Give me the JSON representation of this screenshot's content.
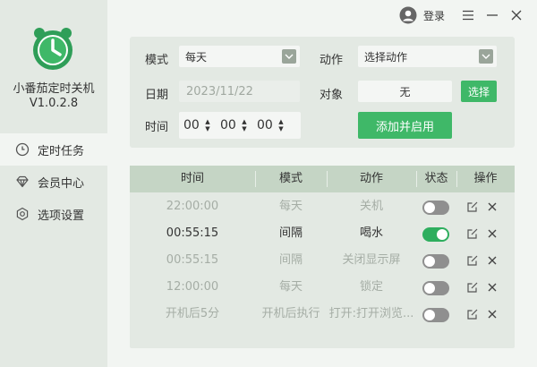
{
  "app": {
    "name": "小番茄定时关机",
    "version": "V1.0.2.8"
  },
  "titlebar": {
    "login_label": "登录"
  },
  "sidebar": {
    "items": [
      {
        "label": "定时任务",
        "icon": "clock-icon",
        "active": true
      },
      {
        "label": "会员中心",
        "icon": "diamond-icon",
        "active": false
      },
      {
        "label": "选项设置",
        "icon": "settings-icon",
        "active": false
      }
    ]
  },
  "form": {
    "mode_label": "模式",
    "mode_value": "每天",
    "action_label": "动作",
    "action_value": "选择动作",
    "date_label": "日期",
    "date_value": "2023/11/22",
    "target_label": "对象",
    "target_value": "无",
    "select_button": "选择",
    "time_label": "时间",
    "hour": "00",
    "minute": "00",
    "second": "00",
    "add_button": "添加并启用"
  },
  "table": {
    "columns": [
      "时间",
      "模式",
      "动作",
      "状态",
      "操作"
    ],
    "rows": [
      {
        "time": "22:00:00",
        "mode": "每天",
        "action": "关机",
        "enabled": false
      },
      {
        "time": "00:55:15",
        "mode": "间隔",
        "action": "喝水",
        "enabled": true
      },
      {
        "time": "00:55:15",
        "mode": "间隔",
        "action": "关闭显示屏",
        "enabled": false
      },
      {
        "time": "12:00:00",
        "mode": "每天",
        "action": "锁定",
        "enabled": false
      },
      {
        "time": "开机后5分",
        "mode": "开机后执行",
        "action": "打开:打开浏览...",
        "enabled": false
      }
    ]
  },
  "colors": {
    "accent": "#3fb868",
    "toggle_on": "#2eae5e",
    "toggle_off": "#8f8f8f",
    "sidebar_bg": "#e3e9e3",
    "header_bg": "#c5d5c5"
  }
}
